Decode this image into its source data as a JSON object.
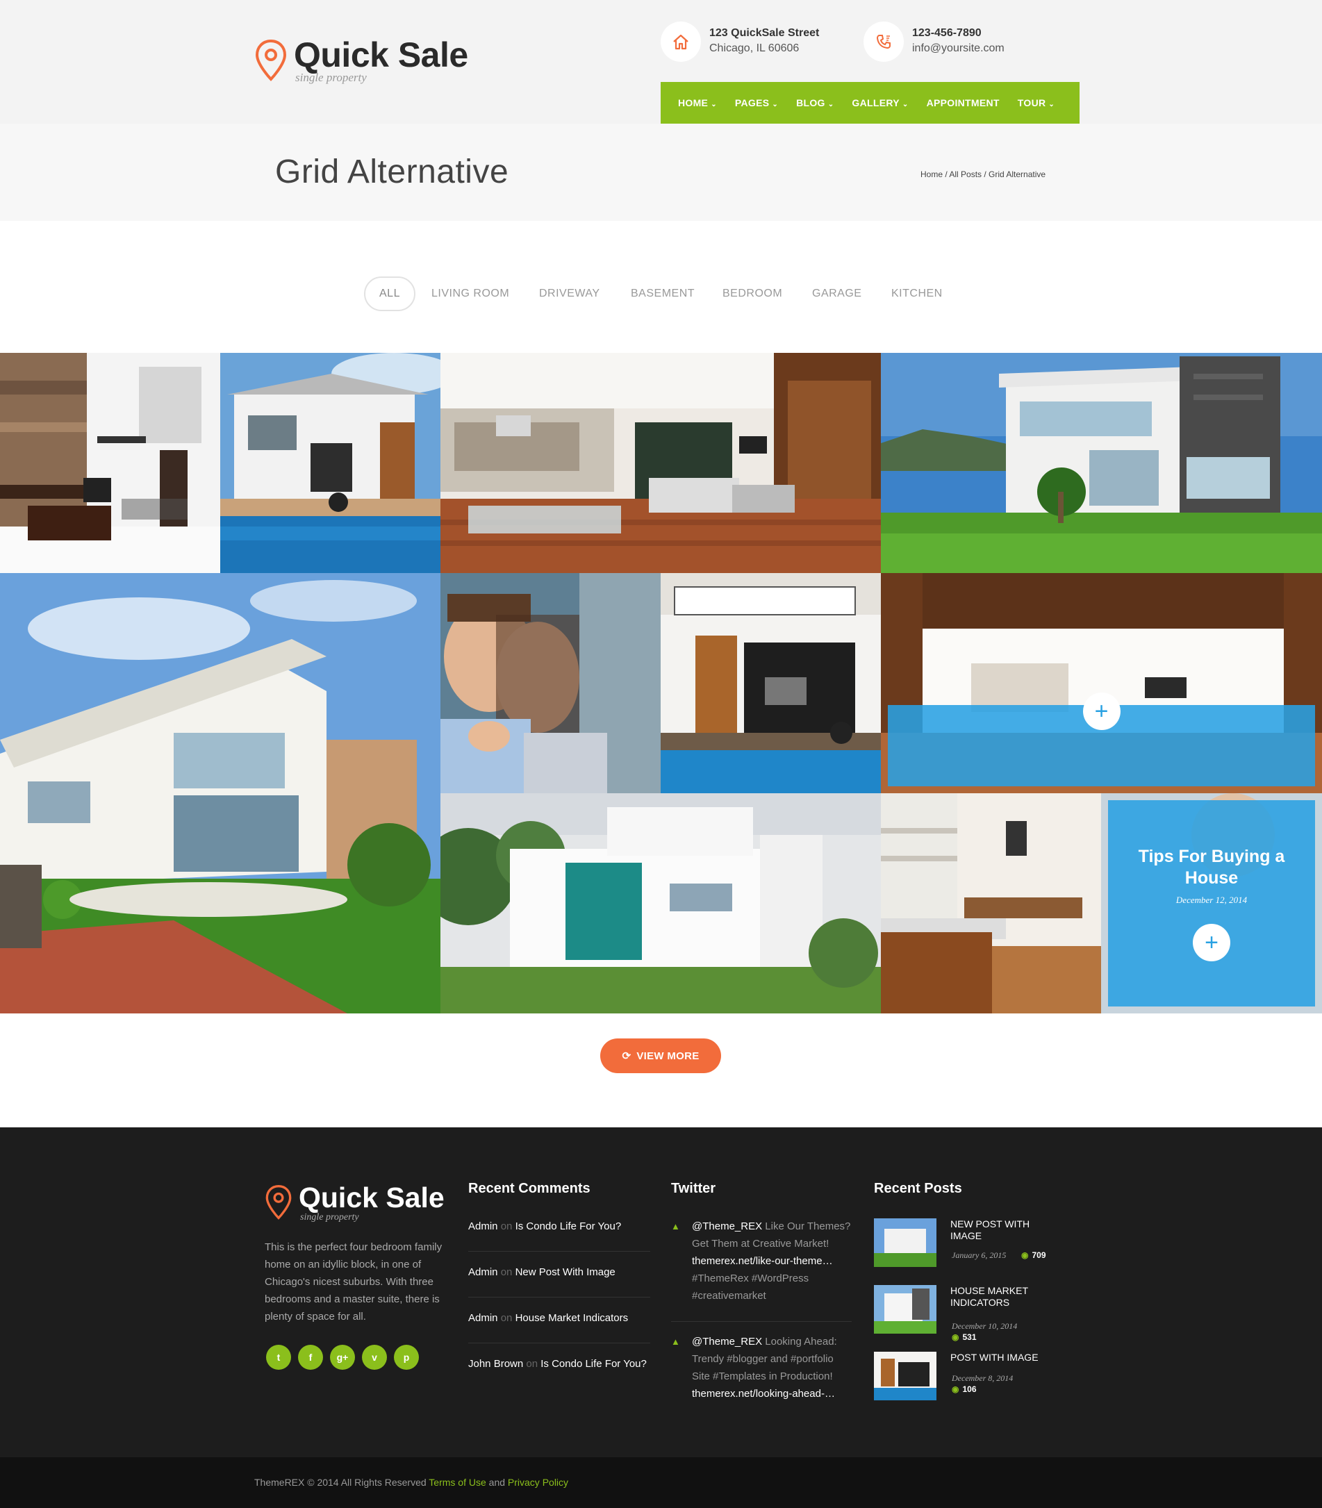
{
  "brand": {
    "name": "Quick Sale",
    "tagline": "single property"
  },
  "contact": {
    "address_line1": "123 QuickSale Street",
    "address_line2": "Chicago, IL 60606",
    "phone": "123-456-7890",
    "email": "info@yoursite.com"
  },
  "nav": {
    "items": [
      {
        "label": "HOME",
        "has_dropdown": true
      },
      {
        "label": "PAGES",
        "has_dropdown": true
      },
      {
        "label": "BLOG",
        "has_dropdown": true
      },
      {
        "label": "GALLERY",
        "has_dropdown": true
      },
      {
        "label": "APPOINTMENT",
        "has_dropdown": false
      },
      {
        "label": "TOUR",
        "has_dropdown": true
      }
    ],
    "color": "#8bbf1c"
  },
  "page": {
    "title": "Grid Alternative",
    "breadcrumb": "Home / All Posts / Grid Alternative"
  },
  "filters": [
    "ALL",
    "LIVING ROOM",
    "DRIVEWAY",
    "BASEMENT",
    "BEDROOM",
    "GARAGE",
    "KITCHEN"
  ],
  "grid": {
    "hover_overlay": {
      "icon": "plus-icon"
    },
    "featured_post": {
      "title": "Tips For Buying a House",
      "date": "December 12, 2014",
      "icon": "plus-icon"
    },
    "overlay_color": "#29a1e2"
  },
  "view_more": {
    "label": "VIEW MORE",
    "icon": "refresh-icon",
    "color": "#f26c3b"
  },
  "footer": {
    "brand": {
      "name": "Quick Sale",
      "tagline": "single property"
    },
    "about": "This is the perfect four bedroom family home on an idyllic block, in one of Chicago's nicest suburbs. With three bedrooms and a master suite, there is plenty of space for all.",
    "social": [
      "twitter-icon",
      "facebook-icon",
      "google-plus-icon",
      "vimeo-icon",
      "pinterest-icon"
    ],
    "recent_comments": {
      "heading": "Recent Comments",
      "items": [
        {
          "author": "Admin",
          "on": "on",
          "post": "Is Condo Life For You?"
        },
        {
          "author": "Admin",
          "on": "on",
          "post": "New Post With Image"
        },
        {
          "author": "Admin",
          "on": "on",
          "post": "House Market Indicators"
        },
        {
          "author": "John Brown",
          "on": "on",
          "post": "Is Condo Life For You?"
        }
      ]
    },
    "twitter": {
      "heading": "Twitter",
      "tweets": [
        {
          "handle": "@Theme_REX",
          "text1": "Like Our Themes? Get Them at Creative Market!",
          "link": "themerex.net/like-our-theme…",
          "tags": "#ThemeRex #WordPress #creativemarket"
        },
        {
          "handle": "@Theme_REX",
          "text1": "Looking Ahead: Trendy #blogger and #portfolio Site #Templates in Production!",
          "link": "themerex.net/looking-ahead-…",
          "tags": ""
        }
      ]
    },
    "recent_posts": {
      "heading": "Recent Posts",
      "items": [
        {
          "title": "NEW POST WITH IMAGE",
          "date": "January 6, 2015",
          "views": "709"
        },
        {
          "title": "HOUSE MARKET INDICATORS",
          "date": "December 10, 2014",
          "views": "531"
        },
        {
          "title": "POST WITH IMAGE",
          "date": "December 8, 2014",
          "views": "106"
        }
      ]
    }
  },
  "copyright": {
    "text": "ThemeREX © 2014 All Rights Reserved",
    "terms": "Terms of Use",
    "and": "and",
    "privacy": "Privacy Policy"
  },
  "colors": {
    "accent_green": "#8bbf1c",
    "accent_orange": "#f26c3b",
    "accent_blue": "#29a1e2",
    "footer_bg": "#1d1d1d"
  }
}
